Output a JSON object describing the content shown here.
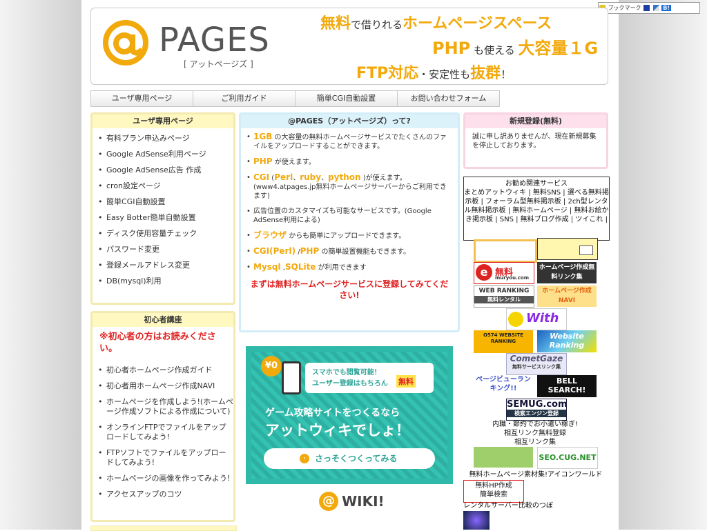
{
  "bookmark_bar": {
    "label": "ブックマーク",
    "badge": "B!"
  },
  "header": {
    "logo_text": "PAGES",
    "logo_sub": "[ アットページズ ]",
    "tag1_a": "無料",
    "tag1_b": "で借りれる",
    "tag1_c": "ホームページスペース",
    "tag2_a": "PHP",
    "tag2_b": " も使える ",
    "tag2_c": "大容量１G",
    "tag3_a": "FTP対応",
    "tag3_b": "・安定性も",
    "tag3_c": "抜群",
    "tag3_d": "！"
  },
  "nav": [
    "ユーザ専用ページ",
    "ご利用ガイド",
    "簡単CGI自動設置",
    "お問い合わせフォーム"
  ],
  "user_panel": {
    "title": "ユーザ専用ページ",
    "items": [
      "有料プラン申込みページ",
      "Google AdSense利用ページ",
      "Google AdSense広告 作成",
      "cron設定ページ",
      "簡単CGI自動設置",
      "Easy Botter簡単自動設置",
      "ディスク使用容量チェック",
      "パスワード変更",
      "登録メールアドレス変更",
      "DB(mysql)利用"
    ]
  },
  "beginner_panel": {
    "title": "初心者講座",
    "warning": "※初心者の方はお読みください。",
    "items": [
      "初心者ホームページ作成ガイド",
      "初心者用ホームページ作成NAVI",
      "ホームページを作成しよう!(ホームページ作成ソフトによる作成について)",
      "オンラインFTPでファイルをアップロードしてみよう!",
      "FTPソフトでファイルをアップロードしてみよう!",
      "ホームページの画像を作ってみよう!",
      "アクセスアップのコツ"
    ]
  },
  "about": {
    "title": "@PAGES（アットページズ）って?",
    "p1_hl": "1GB",
    "p1": " の大容量の無料ホームページサービスでたくさんのファイルをアップロードすることができます。",
    "p2_hl": "PHP",
    "p2": " が使えます。",
    "p3_hl": "CGI",
    "p3_a": " (",
    "p3_hl2": "Perl",
    "p3_b": "、",
    "p3_hl3": "ruby",
    "p3_c": "、",
    "p3_hl4": "python",
    "p3_d": " )が使えます。(www4.atpages.jp無料ホームページサーバーからご利用できます)",
    "p4": "広告位置のカスタマイズも可能なサービスです。(Google AdSense利用による)",
    "p5_hl": "ブラウザ",
    "p5": " からも簡単にアップロードできます。",
    "p6_hl": "CGI(Perl)",
    "p6_a": " /",
    "p6_hl2": "PHP",
    "p6_b": " の簡単設置機能もできます。",
    "p7_hl": "Mysql",
    "p7_a": " ,",
    "p7_hl2": "SQLite",
    "p7_b": " が利用できます",
    "cta": "まずは無料ホームページサービスに登録してみてください!"
  },
  "banner": {
    "price": "¥0",
    "line1": "スマホでも閲覧可能！",
    "line2": "ユーザー登録はもちろん",
    "free": "無料",
    "headline1": "ゲーム攻略サイトをつくるなら",
    "headline2": "アットウィキでしょ！",
    "button": "さっそくつくってみる",
    "wiki_logo": "WIKI!"
  },
  "register": {
    "title": "新規登録(無料)",
    "text": "誠に申し訳ありませんが、現在新規募集を停止しております。"
  },
  "related": {
    "title": "お勧め関連サービス",
    "links": [
      "まとめアットウィキ",
      "無料SNS",
      "選べる無料掲示板",
      "フォーラム型無料掲示板",
      "2ch型レンタル無料掲示板",
      "無料ホームページ",
      "無料お絵かき掲示板",
      "SNS",
      "無料ブログ作成",
      "ツイこれ"
    ]
  },
  "thumbs": {
    "muryou": "無料",
    "muryou_url": "muryou.com",
    "hp_link": "ホームページ作成無料リンク集",
    "web_ranking": "WEB RANKING",
    "web_ranking_sub": "無料レンタル",
    "hp_navi": "ホームページ作成NAVI",
    "with": "With",
    "o574": "O574 WEBSITE RANKING",
    "website_ranking": "Website Ranking",
    "comet": "CometGaze",
    "comet_sub": "無料サービスリンク集",
    "hp_review": "ページビューランキング!!",
    "bell": "BELL SEARCH!",
    "semug": "SEMUG.com",
    "semug_sub": "検索エンジン登録",
    "seo": "SEO.CUG.NET"
  },
  "right_texts": {
    "naishoku": "内職・節約でお小遣い稼ぎ!",
    "sogo": "相互リンク無料登録",
    "sogo2": "相互リンク集",
    "sozai": "無料ホームページ素材集!アイコンワールド",
    "hp_make": "無料HP作成",
    "easy": "簡単検索",
    "rental": "レンタルサーバー比較のつぼ"
  },
  "colors": {
    "accent": "#f2a90b",
    "warn": "#e02020",
    "banner": "#2fb9a9"
  }
}
